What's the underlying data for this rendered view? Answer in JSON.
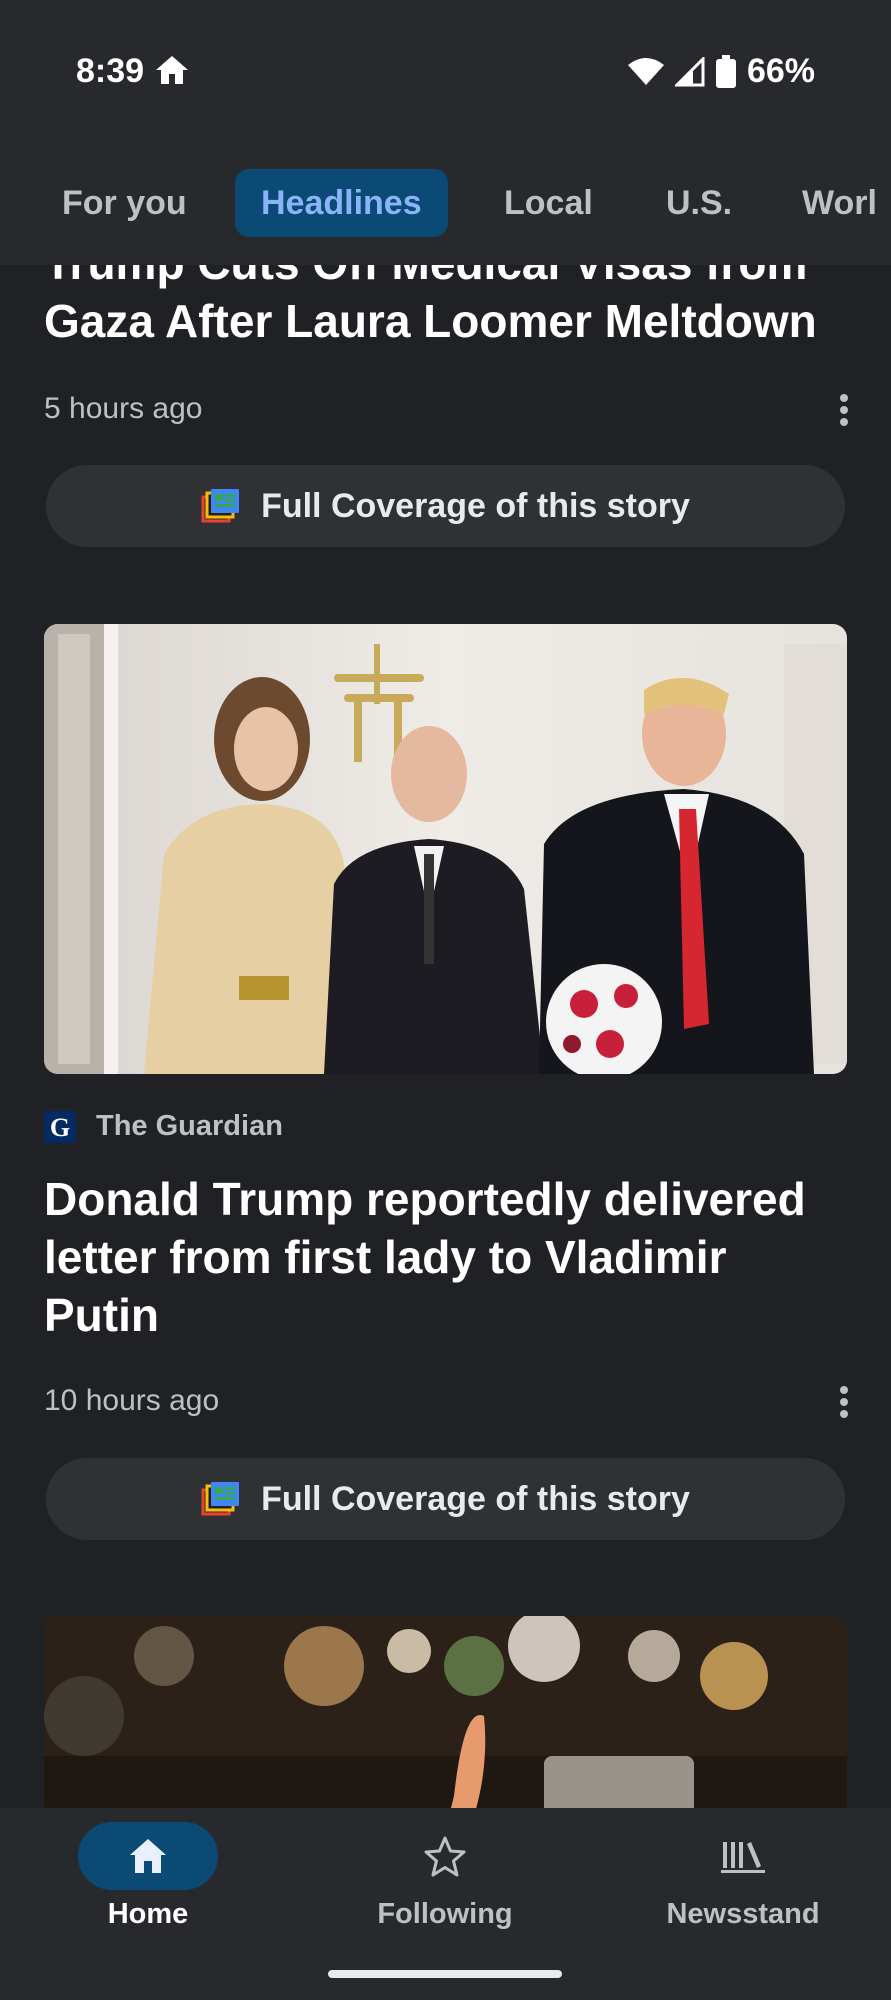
{
  "status_bar": {
    "time": "8:39",
    "battery": "66%"
  },
  "tabs": [
    {
      "label": "For you",
      "active": false
    },
    {
      "label": "Headlines",
      "active": true
    },
    {
      "label": "Local",
      "active": false
    },
    {
      "label": "U.S.",
      "active": false
    },
    {
      "label": "Worl",
      "active": false
    }
  ],
  "articles": [
    {
      "headline_line1": "Trump Cuts Off Medical Visas from",
      "headline_line2": "Gaza After Laura Loomer Meltdown",
      "time": "5 hours ago",
      "coverage_label": "Full Coverage of this story"
    },
    {
      "source": "The Guardian",
      "headline": "Donald Trump reportedly delivered letter from first lady to Vladimir Putin",
      "time": "10 hours ago",
      "coverage_label": "Full Coverage of this story"
    }
  ],
  "bottom_nav": [
    {
      "label": "Home",
      "icon": "home-icon",
      "active": true
    },
    {
      "label": "Following",
      "icon": "star-icon",
      "active": false
    },
    {
      "label": "Newsstand",
      "icon": "newsstand-icon",
      "active": false
    }
  ],
  "colors": {
    "background": "#202124",
    "accent": "#8ab4f8",
    "active_pill": "#0b4a75"
  }
}
